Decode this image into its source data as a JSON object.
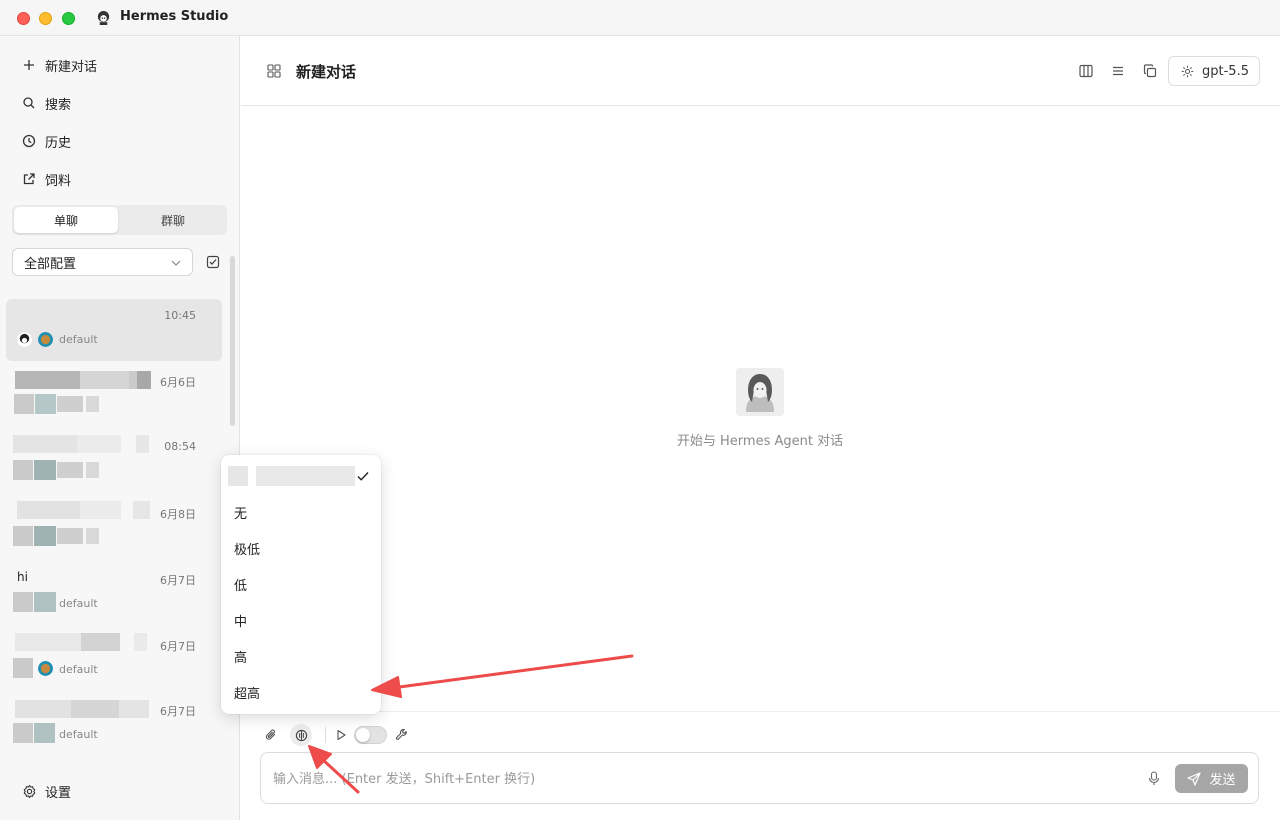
{
  "window": {
    "title": "Hermes Studio"
  },
  "sidebar": {
    "nav": [
      {
        "label": "新建对话",
        "icon": "plus-icon"
      },
      {
        "label": "搜索",
        "icon": "search-icon"
      },
      {
        "label": "历史",
        "icon": "clock-icon"
      },
      {
        "label": "饲料",
        "icon": "external-link-icon"
      }
    ],
    "tabs": {
      "single": "单聊",
      "group": "群聊"
    },
    "profile_select": "全部配置",
    "conversations": [
      {
        "title": "",
        "time": "10:45",
        "profile": "default"
      },
      {
        "title": "",
        "time": "6月6日",
        "profile": ""
      },
      {
        "title": "",
        "time": "08:54",
        "profile": ""
      },
      {
        "title": "",
        "time": "6月8日",
        "profile": ""
      },
      {
        "title": "hi",
        "time": "6月7日",
        "profile": "default"
      },
      {
        "title": "",
        "time": "6月7日",
        "profile": "default"
      },
      {
        "title": "",
        "time": "6月7日",
        "profile": "default"
      }
    ],
    "settings_label": "设置"
  },
  "header": {
    "title": "新建对话",
    "model": "gpt-5.5"
  },
  "main": {
    "empty_text": "开始与 Hermes Agent 对话"
  },
  "reasoning_menu": {
    "options": [
      "无",
      "极低",
      "低",
      "中",
      "高",
      "超高"
    ]
  },
  "composer": {
    "placeholder": "输入消息... (Enter 发送，Shift+Enter 换行)",
    "send_label": "发送"
  },
  "colors": {
    "annotation_arrow": "#ee4b4b",
    "send_disabled": "#a6a6a6"
  }
}
